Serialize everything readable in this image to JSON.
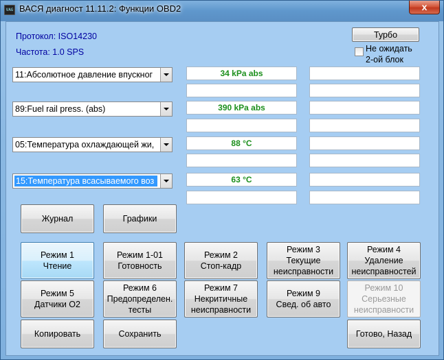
{
  "window": {
    "title": "ВАСЯ диагност 11.11.2:  Функции OBD2",
    "icon": "vag-app-icon",
    "icon_text": "VAG",
    "close_label": "x"
  },
  "info": {
    "protocol": "Протокол: ISO14230",
    "frequency": "Частота: 1.0 SPS"
  },
  "turbo": {
    "button_label": "Турбо",
    "checkbox_label_1": "Не ожидать",
    "checkbox_label_2": "2-ой блок",
    "checked": false
  },
  "channels": [
    {
      "selector": "11:Абсолютное давление впускног",
      "value": "34 kPa abs",
      "value2": "",
      "value3": "",
      "value4": "",
      "selected": false
    },
    {
      "selector": "89:Fuel rail press. (abs)",
      "value": "390 kPa abs",
      "value2": "",
      "value3": "",
      "value4": "",
      "selected": false
    },
    {
      "selector": "05:Температура охлаждающей жи,",
      "value": "88 °C",
      "value2": "",
      "value3": "",
      "value4": "",
      "selected": false
    },
    {
      "selector": "15:Температура всасываемого воз",
      "value": "63 °C",
      "value2": "",
      "value3": "",
      "value4": "",
      "selected": true
    }
  ],
  "buttons": {
    "journal": "Журнал",
    "graphs": "Графики",
    "mode1": [
      "Режим 1",
      "Чтение"
    ],
    "mode1_01": [
      "Режим 1-01",
      "Готовность"
    ],
    "mode2": [
      "Режим 2",
      "Стоп-кадр"
    ],
    "mode3": [
      "Режим 3",
      "Текущие",
      "неисправности"
    ],
    "mode4": [
      "Режим 4",
      "Удаление",
      "неисправностей"
    ],
    "mode5": [
      "Режим 5",
      "Датчики О2"
    ],
    "mode6": [
      "Режим 6",
      "Предопределен.",
      "тесты"
    ],
    "mode7": [
      "Режим 7",
      "Некритичные",
      "неисправности"
    ],
    "mode9": [
      "Режим 9",
      "Свед. об авто"
    ],
    "mode10": [
      "Режим 10",
      "Серьезные",
      "неисправности"
    ],
    "copy": "Копировать",
    "save": "Сохранить",
    "done": "Готово, Назад"
  },
  "colors": {
    "value_text": "#1c8f1c",
    "info_text": "#0000a0",
    "selection": "#3399ff"
  }
}
